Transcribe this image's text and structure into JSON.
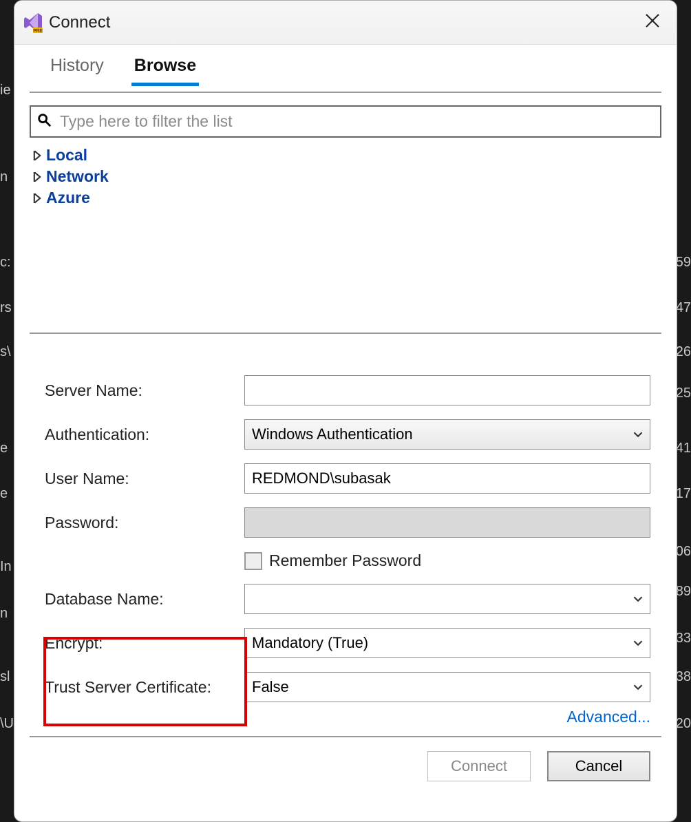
{
  "backdrop": [
    "ie",
    "n",
    "c:",
    "rs",
    "s\\",
    "e",
    "e",
    "In",
    "n",
    "sl",
    "\\U",
    "59",
    "47",
    "26",
    "25",
    "41",
    "17",
    "06",
    "89",
    "33",
    "38",
    "20"
  ],
  "dialog": {
    "title": "Connect",
    "tabs": [
      {
        "label": "History",
        "active": false
      },
      {
        "label": "Browse",
        "active": true
      }
    ],
    "filter_placeholder": "Type here to filter the list",
    "tree": [
      {
        "label": "Local"
      },
      {
        "label": "Network"
      },
      {
        "label": "Azure"
      }
    ],
    "form": {
      "server_name": {
        "label": "Server Name:",
        "value": ""
      },
      "authentication": {
        "label": "Authentication:",
        "selected": "Windows Authentication"
      },
      "user_name": {
        "label": "User Name:",
        "value": "REDMOND\\subasak"
      },
      "password": {
        "label": "Password:",
        "value": ""
      },
      "remember_password": {
        "label": "Remember Password",
        "checked": false
      },
      "database_name": {
        "label": "Database Name:",
        "selected": ""
      },
      "encrypt": {
        "label": "Encrypt:",
        "selected": "Mandatory (True)"
      },
      "trust_cert": {
        "label": "Trust Server Certificate:",
        "selected": "False"
      },
      "advanced": "Advanced..."
    },
    "footer": {
      "connect": "Connect",
      "cancel": "Cancel"
    }
  }
}
